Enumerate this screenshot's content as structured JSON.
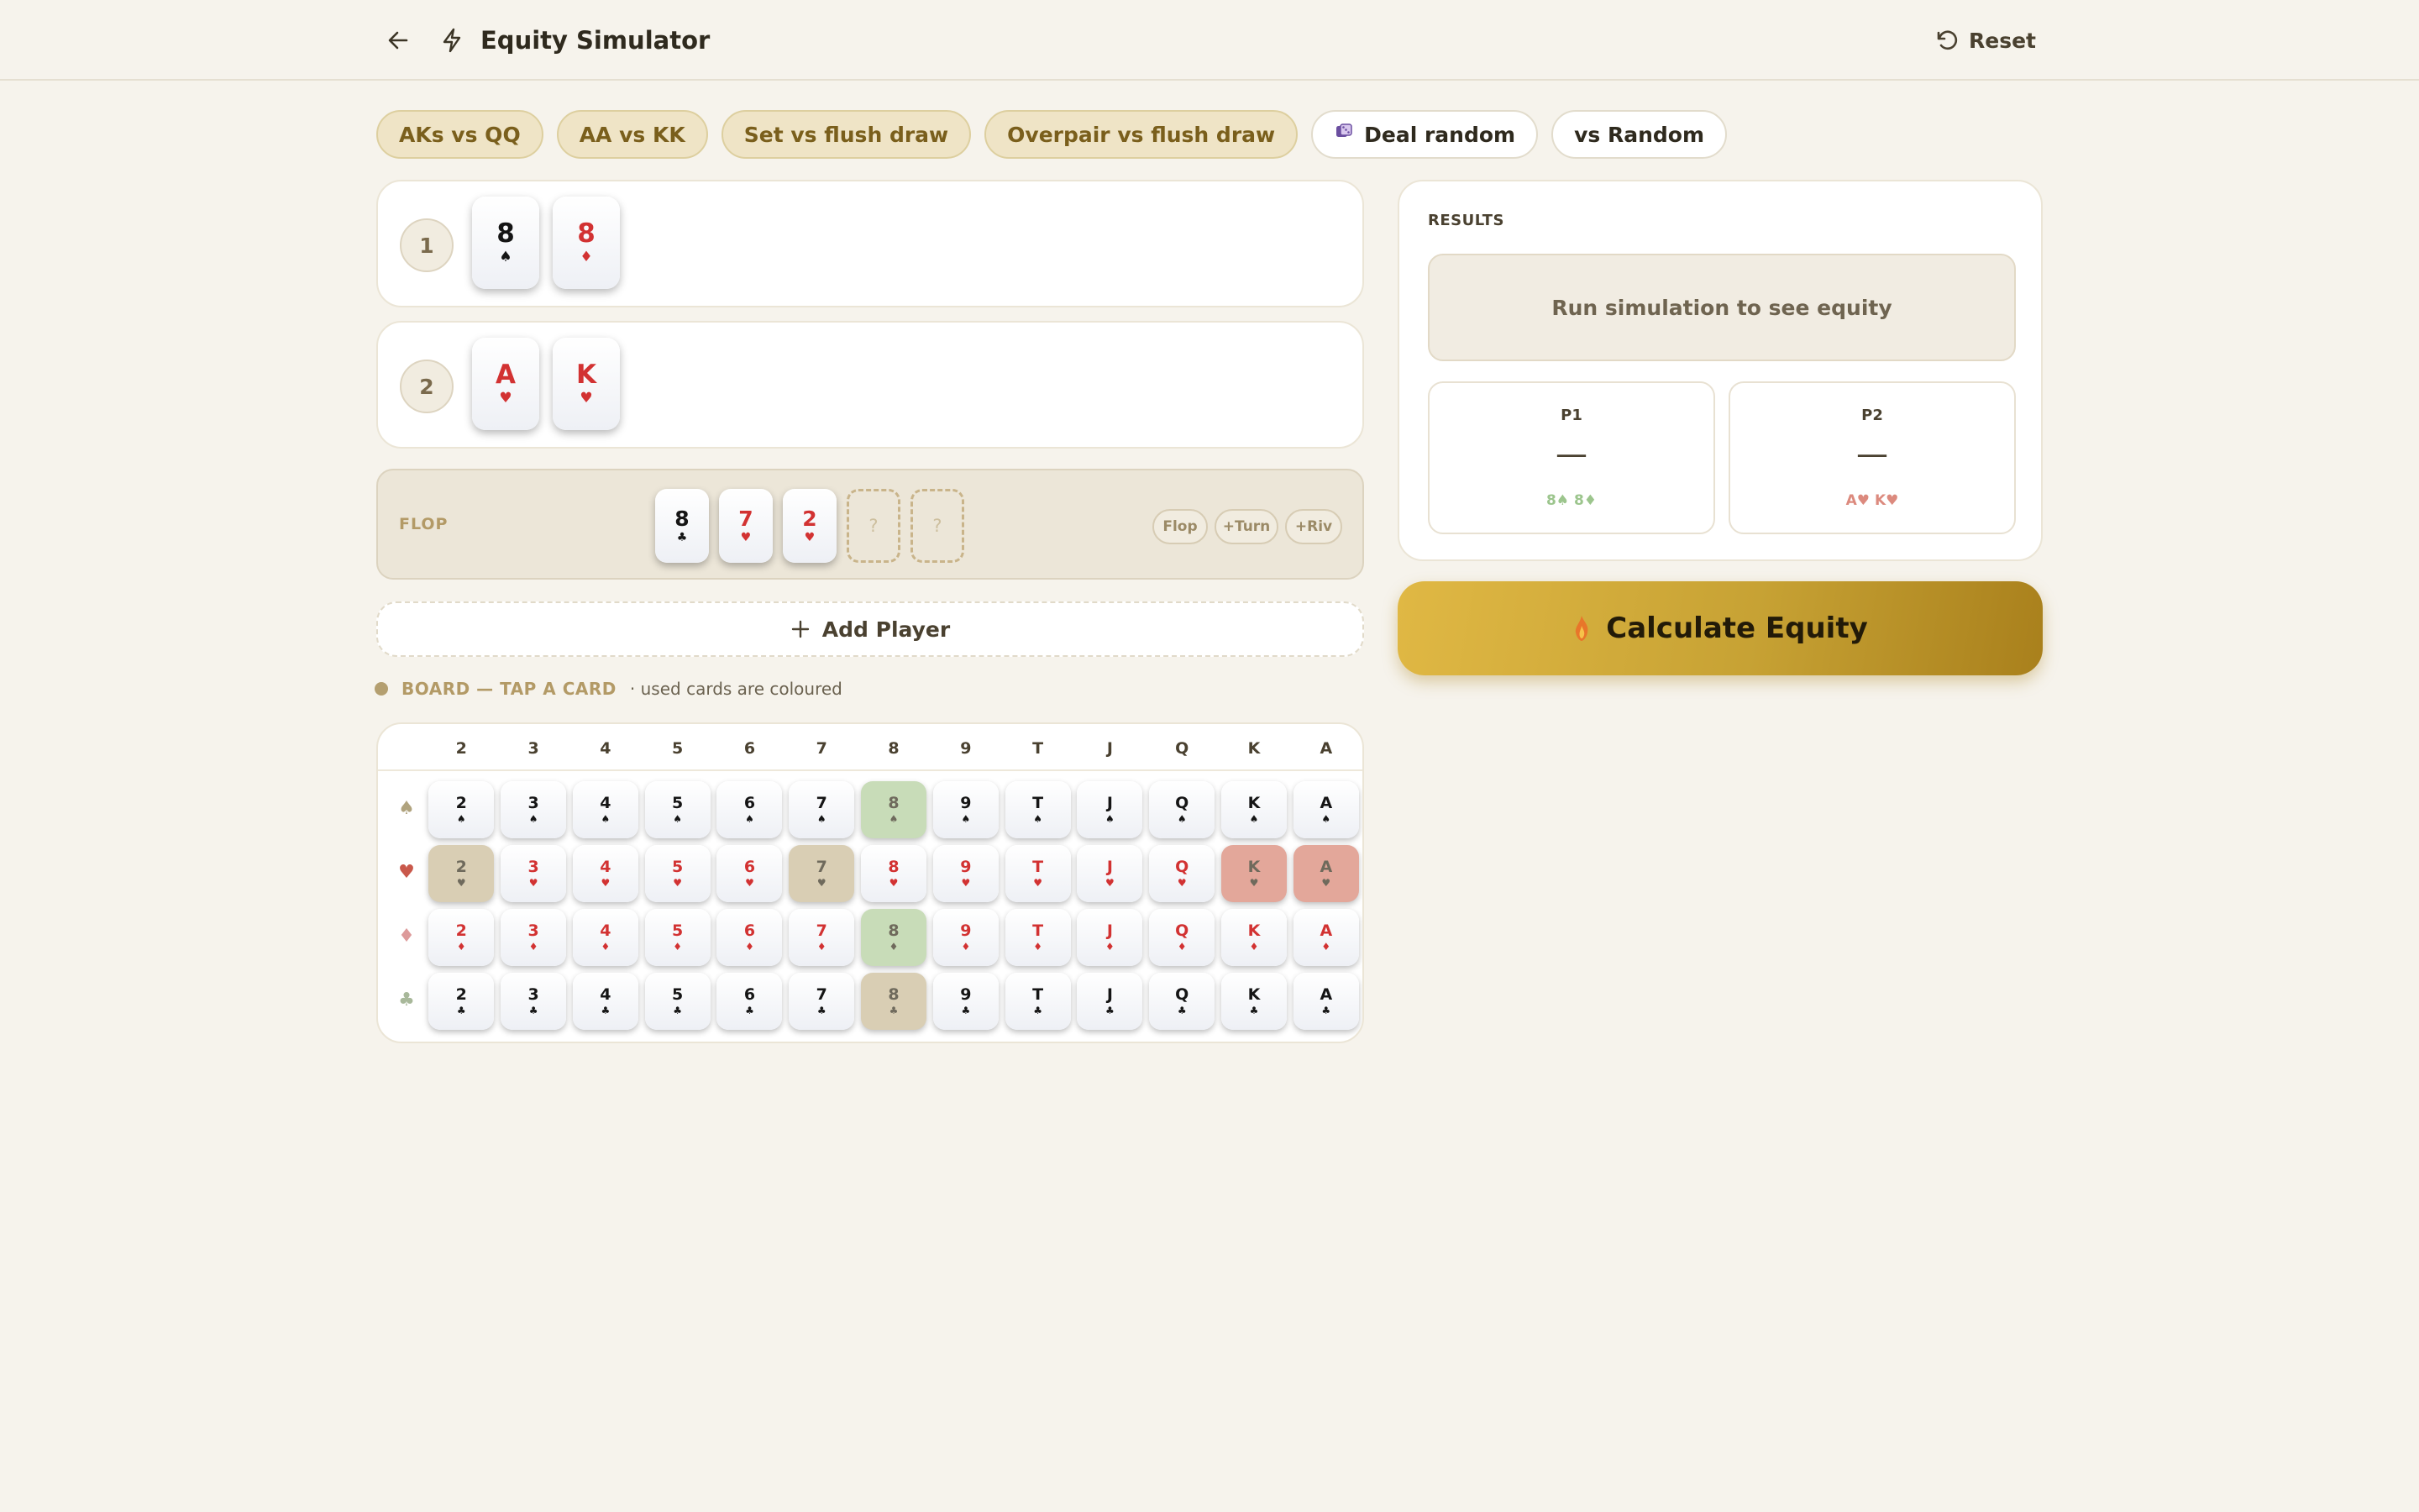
{
  "header": {
    "title": "Equity Simulator",
    "reset_label": "Reset"
  },
  "presets": [
    {
      "label": "AKs vs QQ",
      "style": "preset"
    },
    {
      "label": "AA vs KK",
      "style": "preset"
    },
    {
      "label": "Set vs flush draw",
      "style": "preset"
    },
    {
      "label": "Overpair vs flush draw",
      "style": "preset"
    },
    {
      "label": "Deal random",
      "style": "plain",
      "icon": "dice-icon"
    },
    {
      "label": "vs Random",
      "style": "plain"
    }
  ],
  "players": [
    {
      "number": "1",
      "cards": [
        {
          "rank": "8",
          "suit": "♠",
          "color": "black"
        },
        {
          "rank": "8",
          "suit": "♦",
          "color": "red"
        }
      ]
    },
    {
      "number": "2",
      "cards": [
        {
          "rank": "A",
          "suit": "♥",
          "color": "red"
        },
        {
          "rank": "K",
          "suit": "♥",
          "color": "red"
        }
      ]
    }
  ],
  "board": {
    "label": "FLOP",
    "cards": [
      {
        "rank": "8",
        "suit": "♣",
        "color": "black"
      },
      {
        "rank": "7",
        "suit": "♥",
        "color": "red"
      },
      {
        "rank": "2",
        "suit": "♥",
        "color": "red"
      }
    ],
    "empty_slots": [
      "?",
      "?"
    ],
    "street_buttons": [
      "Flop",
      "+Turn",
      "+Riv"
    ]
  },
  "add_player_label": "Add Player",
  "legend": {
    "title": "BOARD — TAP A CARD",
    "note": "· used cards are coloured"
  },
  "deck": {
    "ranks": [
      "2",
      "3",
      "4",
      "5",
      "6",
      "7",
      "8",
      "9",
      "T",
      "J",
      "Q",
      "K",
      "A"
    ],
    "suits": [
      {
        "symbol": "♠",
        "color": "black",
        "label_color": "#b0a37e"
      },
      {
        "symbol": "♥",
        "color": "red",
        "label_color": "#c9584b"
      },
      {
        "symbol": "♦",
        "color": "red",
        "label_color": "#dd9a9a"
      },
      {
        "symbol": "♣",
        "color": "black",
        "label_color": "#a8b89a"
      }
    ],
    "used": {
      "♠8": "green",
      "♥2": "board",
      "♥7": "board",
      "♥K": "red",
      "♥A": "red",
      "♦8": "green",
      "♣8": "board"
    }
  },
  "results": {
    "title": "RESULTS",
    "message": "Run simulation to see equity",
    "players": [
      {
        "label": "P1",
        "value": "—",
        "hand": "8♠ 8♦",
        "color": "#9cc58d"
      },
      {
        "label": "P2",
        "value": "—",
        "hand": "A♥ K♥",
        "color": "#dc8a7e"
      }
    ]
  },
  "calculate_label": "Calculate Equity",
  "colors": {
    "background": "#f6f3ec",
    "accent_gold": "#c7a234",
    "card_red": "#d23232"
  }
}
